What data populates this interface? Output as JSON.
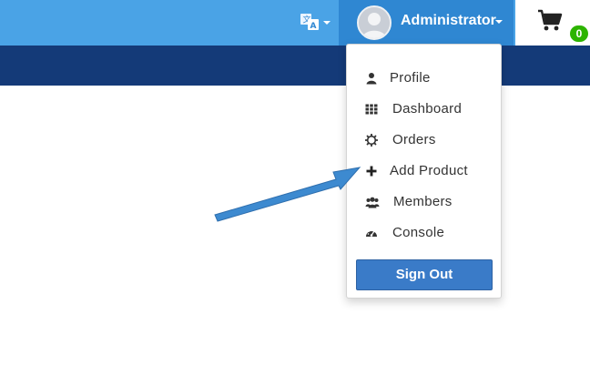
{
  "header": {
    "language_icon": "translate-icon",
    "user": {
      "name": "Administrator",
      "avatar_icon": "default-user-avatar"
    },
    "cart": {
      "icon": "shopping-cart-icon",
      "count": "0"
    }
  },
  "user_menu": {
    "items": [
      {
        "label": "Profile",
        "icon": "user-icon"
      },
      {
        "label": "Dashboard",
        "icon": "grid-icon"
      },
      {
        "label": "Orders",
        "icon": "cog-icon"
      },
      {
        "label": "Add Product",
        "icon": "plus-icon"
      },
      {
        "label": "Members",
        "icon": "users-icon"
      },
      {
        "label": "Console",
        "icon": "gauge-icon"
      }
    ],
    "signout_label": "Sign Out"
  },
  "colors": {
    "topbar": "#4aa3e6",
    "user_toggle": "#2f87d2",
    "nav_band": "#143a78",
    "signout_button": "#3a7bc8",
    "badge": "#2db400",
    "annotation_arrow": "#3d8ad0"
  }
}
